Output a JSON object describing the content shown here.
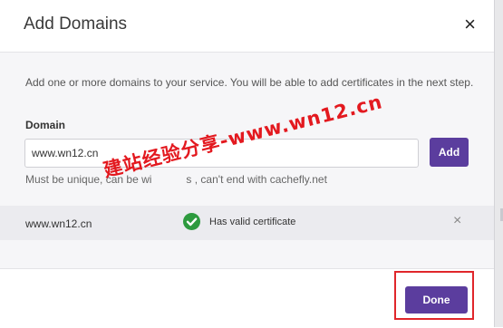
{
  "dialog": {
    "title": "Add Domains",
    "close_icon": "×"
  },
  "form": {
    "description": "Add one or more domains to your service. You will be able to add certificates in the next step.",
    "domain_label": "Domain",
    "domain_value": "www.wn12.cn",
    "add_label": "Add",
    "hint_prefix": "Must be unique, can be wi",
    "hint_suffix": "s , can't end with cachefly.net"
  },
  "domains": [
    {
      "name": "www.wn12.cn",
      "status": "Has valid certificate",
      "status_icon": "check-circle-icon",
      "remove_icon": "×"
    }
  ],
  "footer": {
    "done_label": "Done"
  },
  "watermark": {
    "text": "建站经验分享-www.wn12.cn"
  },
  "colors": {
    "accent": "#5b3d9e",
    "success": "#2d9a3e",
    "highlight": "#e0262b"
  }
}
